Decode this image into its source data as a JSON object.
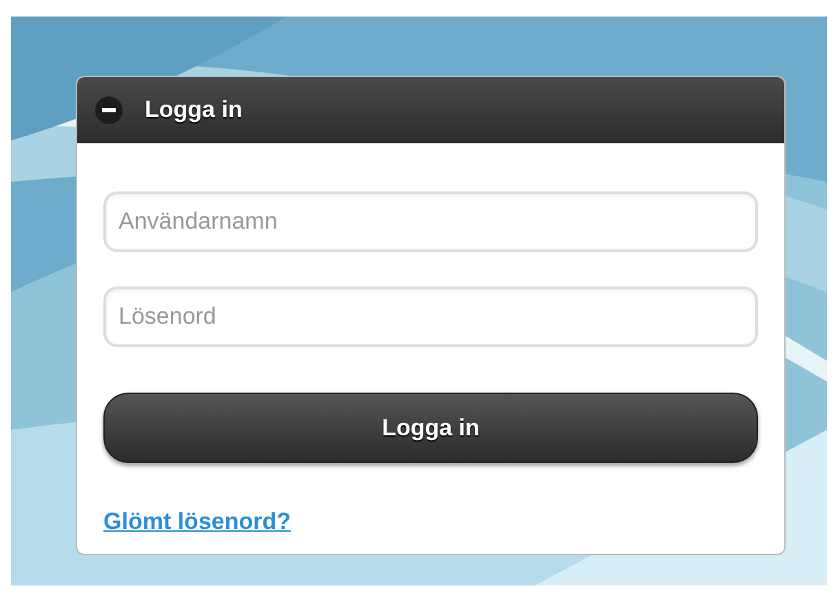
{
  "panel": {
    "title": "Logga in",
    "expanded": true
  },
  "fields": [
    {
      "placeholder": "Användarnamn"
    },
    {
      "placeholder": "Lösenord"
    }
  ],
  "submit_button": "Logga in",
  "forgot_link": "Glömt lösenord?"
}
